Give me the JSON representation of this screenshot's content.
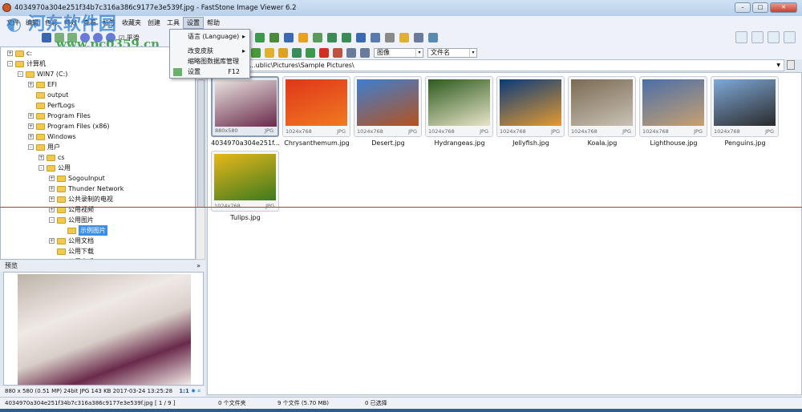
{
  "window": {
    "title": "4034970a304e251f34b7c316a386c9177e3e539f.jpg  -  FastStone Image Viewer 6.2"
  },
  "watermark": {
    "text": "河东软件园",
    "url": "www.pc0359.cn"
  },
  "menubar": [
    "文件",
    "编辑",
    "色彩",
    "特效",
    "查看",
    "标签",
    "收藏夹",
    "创建",
    "工具",
    "设置",
    "帮助"
  ],
  "settings_menu": [
    {
      "label": "语言 (Language)",
      "submenu": true
    },
    {
      "label": "改变皮肤",
      "submenu": true
    },
    {
      "label": "缩略图数据库管理"
    },
    {
      "label": "设置",
      "shortcut": "F12"
    }
  ],
  "left_toolbar": {
    "smooth_label": "平滑",
    "smooth_checked": true
  },
  "tree": [
    {
      "label": "c:",
      "level": 0,
      "exp": "+"
    },
    {
      "label": "计算机",
      "level": 0,
      "exp": "-"
    },
    {
      "label": "WIN7 (C:)",
      "level": 1,
      "exp": "-"
    },
    {
      "label": "EFI",
      "level": 2,
      "exp": "+"
    },
    {
      "label": "output",
      "level": 2,
      "exp": ""
    },
    {
      "label": "PerfLogs",
      "level": 2,
      "exp": ""
    },
    {
      "label": "Program Files",
      "level": 2,
      "exp": "+"
    },
    {
      "label": "Program Files (x86)",
      "level": 2,
      "exp": "+"
    },
    {
      "label": "Windows",
      "level": 2,
      "exp": "+"
    },
    {
      "label": "用户",
      "level": 2,
      "exp": "-"
    },
    {
      "label": "cs",
      "level": 3,
      "exp": "+"
    },
    {
      "label": "公用",
      "level": 3,
      "exp": "-"
    },
    {
      "label": "SogouInput",
      "level": 4,
      "exp": "+"
    },
    {
      "label": "Thunder Network",
      "level": 4,
      "exp": "+"
    },
    {
      "label": "公共录制的电视",
      "level": 4,
      "exp": "+"
    },
    {
      "label": "公用视频",
      "level": 4,
      "exp": "+"
    },
    {
      "label": "公用图片",
      "level": 4,
      "exp": "-"
    },
    {
      "label": "示例图片",
      "level": 5,
      "exp": "",
      "selected": true
    },
    {
      "label": "公用文档",
      "level": 4,
      "exp": "+"
    },
    {
      "label": "公用下载",
      "level": 4,
      "exp": ""
    },
    {
      "label": "公用音乐",
      "level": 4,
      "exp": "+"
    }
  ],
  "preview": {
    "header": "预览",
    "info": "880 x 580 (0.51 MP)  24bit  JPG   143 KB   2017-03-24 13:25:28",
    "ratio": "1:1"
  },
  "filter": {
    "type": "图像",
    "sort": "文件名"
  },
  "path": "...ublic\\Pictures\\Sample Pictures\\",
  "thumbnails": [
    {
      "name": "4034970a304e251f...",
      "dim": "880x580",
      "fmt": "JPG",
      "colors": [
        "#e9e3e0",
        "#6a2a4a"
      ],
      "current": true
    },
    {
      "name": "Chrysanthemum.jpg",
      "dim": "1024x768",
      "fmt": "JPG",
      "colors": [
        "#e0361a",
        "#f07a20"
      ]
    },
    {
      "name": "Desert.jpg",
      "dim": "1024x768",
      "fmt": "JPG",
      "colors": [
        "#3e7fd0",
        "#b5521e"
      ]
    },
    {
      "name": "Hydrangeas.jpg",
      "dim": "1024x768",
      "fmt": "JPG",
      "colors": [
        "#2d5a1e",
        "#e8e4c8"
      ]
    },
    {
      "name": "Jellyfish.jpg",
      "dim": "1024x768",
      "fmt": "JPG",
      "colors": [
        "#0a3a7a",
        "#e49a30"
      ]
    },
    {
      "name": "Koala.jpg",
      "dim": "1024x768",
      "fmt": "JPG",
      "colors": [
        "#7a6a52",
        "#c9c2b5"
      ]
    },
    {
      "name": "Lighthouse.jpg",
      "dim": "1024x768",
      "fmt": "JPG",
      "colors": [
        "#4a6fa8",
        "#c8a070"
      ]
    },
    {
      "name": "Penguins.jpg",
      "dim": "1024x768",
      "fmt": "JPG",
      "colors": [
        "#7fa9d8",
        "#2a2a2a"
      ]
    },
    {
      "name": "Tulips.jpg",
      "dim": "1024x768",
      "fmt": "JPG",
      "colors": [
        "#e7b71a",
        "#3d7a1e"
      ]
    }
  ],
  "status": {
    "file": "4034970a304e251f34b7c316a386c9177e3e539f.jpg [ 1 / 9 ]",
    "folders": "0 个文件夹",
    "files": "9 个文件 (5.70 MB)",
    "selected": "0 已选择"
  }
}
